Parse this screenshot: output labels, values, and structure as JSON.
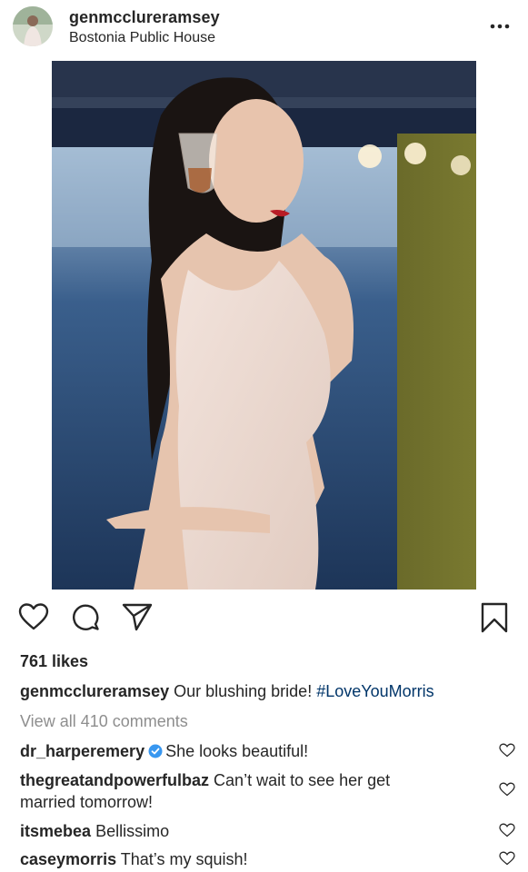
{
  "post": {
    "username": "genmcclureramsey",
    "location": "Bostonia Public House"
  },
  "likes_text": "761 likes",
  "caption": {
    "username": "genmcclureramsey",
    "text": "Our blushing bride!",
    "hashtag": "#LoveYouMorris"
  },
  "view_all_comments": "View all 410 comments",
  "comments": [
    {
      "username": "dr_harperemery",
      "verified": true,
      "text": "She looks beautiful!"
    },
    {
      "username": "thegreatandpowerfulbaz",
      "text": "Can’t wait to see her get",
      "text_cont": "married tomorrow!"
    },
    {
      "username": "itsmebea",
      "text": "Bellissimo"
    },
    {
      "username": "caseymorris",
      "text": "That’s my squish!"
    }
  ],
  "icons": {
    "more": "more-horizontal-icon",
    "like": "heart-icon",
    "comment": "comment-bubble-icon",
    "share": "paper-plane-icon",
    "save": "bookmark-icon",
    "verified": "verified-badge-icon"
  },
  "colors": {
    "text": "#262626",
    "muted": "#8e8e8e",
    "hashtag": "#003569",
    "verified": "#3897f0"
  }
}
